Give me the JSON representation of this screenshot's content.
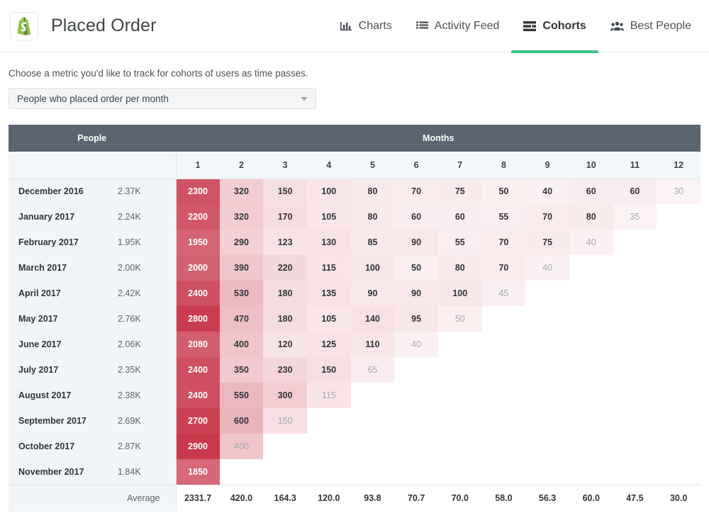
{
  "header": {
    "logo_icon": "shopify-bag-icon",
    "app_title": "Placed Order",
    "nav": [
      {
        "label": "Charts",
        "icon": "bar-chart-icon",
        "active": false
      },
      {
        "label": "Activity Feed",
        "icon": "list-icon",
        "active": false
      },
      {
        "label": "Cohorts",
        "icon": "layers-icon",
        "active": true
      },
      {
        "label": "Best People",
        "icon": "people-icon",
        "active": false
      }
    ],
    "accent_color": "#3ec487"
  },
  "chooser": {
    "label": "Choose a metric you'd like to track for cohorts of users as time passes.",
    "selected": "People who placed order per month",
    "caret_icon": "chevron-down-icon"
  },
  "chart_data": {
    "type": "heatmap",
    "title": "People who placed order per month",
    "group_headers": {
      "people": "People",
      "months": "Months"
    },
    "xlabel": "Months",
    "ylabel": "",
    "categories": [
      "1",
      "2",
      "3",
      "4",
      "5",
      "6",
      "7",
      "8",
      "9",
      "10",
      "11",
      "12"
    ],
    "rows": [
      {
        "cohort": "December 2016",
        "people": "2.37K",
        "values": [
          2300,
          320,
          150,
          100,
          80,
          70,
          75,
          50,
          40,
          60,
          60,
          30
        ],
        "partial": [
          false,
          false,
          false,
          false,
          false,
          false,
          false,
          false,
          false,
          false,
          false,
          true
        ]
      },
      {
        "cohort": "January 2017",
        "people": "2.24K",
        "values": [
          2200,
          320,
          170,
          105,
          80,
          60,
          60,
          55,
          70,
          80,
          35,
          null
        ],
        "partial": [
          false,
          false,
          false,
          false,
          false,
          false,
          false,
          false,
          false,
          false,
          true,
          false
        ]
      },
      {
        "cohort": "February 2017",
        "people": "1.95K",
        "values": [
          1950,
          290,
          123,
          130,
          85,
          90,
          55,
          70,
          75,
          40,
          null,
          null
        ],
        "partial": [
          false,
          false,
          false,
          false,
          false,
          false,
          false,
          false,
          false,
          true,
          false,
          false
        ]
      },
      {
        "cohort": "March 2017",
        "people": "2.00K",
        "values": [
          2000,
          390,
          220,
          115,
          100,
          50,
          80,
          70,
          40,
          null,
          null,
          null
        ],
        "partial": [
          false,
          false,
          false,
          false,
          false,
          false,
          false,
          false,
          true,
          false,
          false,
          false
        ]
      },
      {
        "cohort": "April 2017",
        "people": "2.42K",
        "values": [
          2400,
          530,
          180,
          135,
          90,
          90,
          100,
          45,
          null,
          null,
          null,
          null
        ],
        "partial": [
          false,
          false,
          false,
          false,
          false,
          false,
          false,
          true,
          false,
          false,
          false,
          false
        ]
      },
      {
        "cohort": "May 2017",
        "people": "2.76K",
        "values": [
          2800,
          470,
          180,
          105,
          140,
          95,
          50,
          null,
          null,
          null,
          null,
          null
        ],
        "partial": [
          false,
          false,
          false,
          false,
          false,
          false,
          true,
          false,
          false,
          false,
          false,
          false
        ]
      },
      {
        "cohort": "June 2017",
        "people": "2.06K",
        "values": [
          2080,
          400,
          120,
          125,
          110,
          40,
          null,
          null,
          null,
          null,
          null,
          null
        ],
        "partial": [
          false,
          false,
          false,
          false,
          false,
          true,
          false,
          false,
          false,
          false,
          false,
          false
        ]
      },
      {
        "cohort": "July 2017",
        "people": "2.35K",
        "values": [
          2400,
          350,
          230,
          150,
          65,
          null,
          null,
          null,
          null,
          null,
          null,
          null
        ],
        "partial": [
          false,
          false,
          false,
          false,
          true,
          false,
          false,
          false,
          false,
          false,
          false,
          false
        ]
      },
      {
        "cohort": "August 2017",
        "people": "2.38K",
        "values": [
          2400,
          550,
          300,
          115,
          null,
          null,
          null,
          null,
          null,
          null,
          null,
          null
        ],
        "partial": [
          false,
          false,
          false,
          true,
          false,
          false,
          false,
          false,
          false,
          false,
          false,
          false
        ]
      },
      {
        "cohort": "September 2017",
        "people": "2.69K",
        "values": [
          2700,
          600,
          150,
          null,
          null,
          null,
          null,
          null,
          null,
          null,
          null,
          null
        ],
        "partial": [
          false,
          false,
          true,
          false,
          false,
          false,
          false,
          false,
          false,
          false,
          false,
          false
        ]
      },
      {
        "cohort": "October 2017",
        "people": "2.87K",
        "values": [
          2900,
          400,
          null,
          null,
          null,
          null,
          null,
          null,
          null,
          null,
          null,
          null
        ],
        "partial": [
          false,
          true,
          false,
          false,
          false,
          false,
          false,
          false,
          false,
          false,
          false,
          false
        ]
      },
      {
        "cohort": "November 2017",
        "people": "1.84K",
        "values": [
          1850,
          null,
          null,
          null,
          null,
          null,
          null,
          null,
          null,
          null,
          null,
          null
        ],
        "partial": [
          false,
          false,
          false,
          false,
          false,
          false,
          false,
          false,
          false,
          false,
          false,
          false
        ]
      }
    ],
    "footer_label": "Average",
    "averages": [
      "2331.7",
      "420.0",
      "164.3",
      "120.0",
      "93.8",
      "70.7",
      "70.0",
      "58.0",
      "56.3",
      "60.0",
      "47.5",
      "30.0"
    ],
    "heat_color": "#c8394b",
    "heat_max": 2900
  }
}
